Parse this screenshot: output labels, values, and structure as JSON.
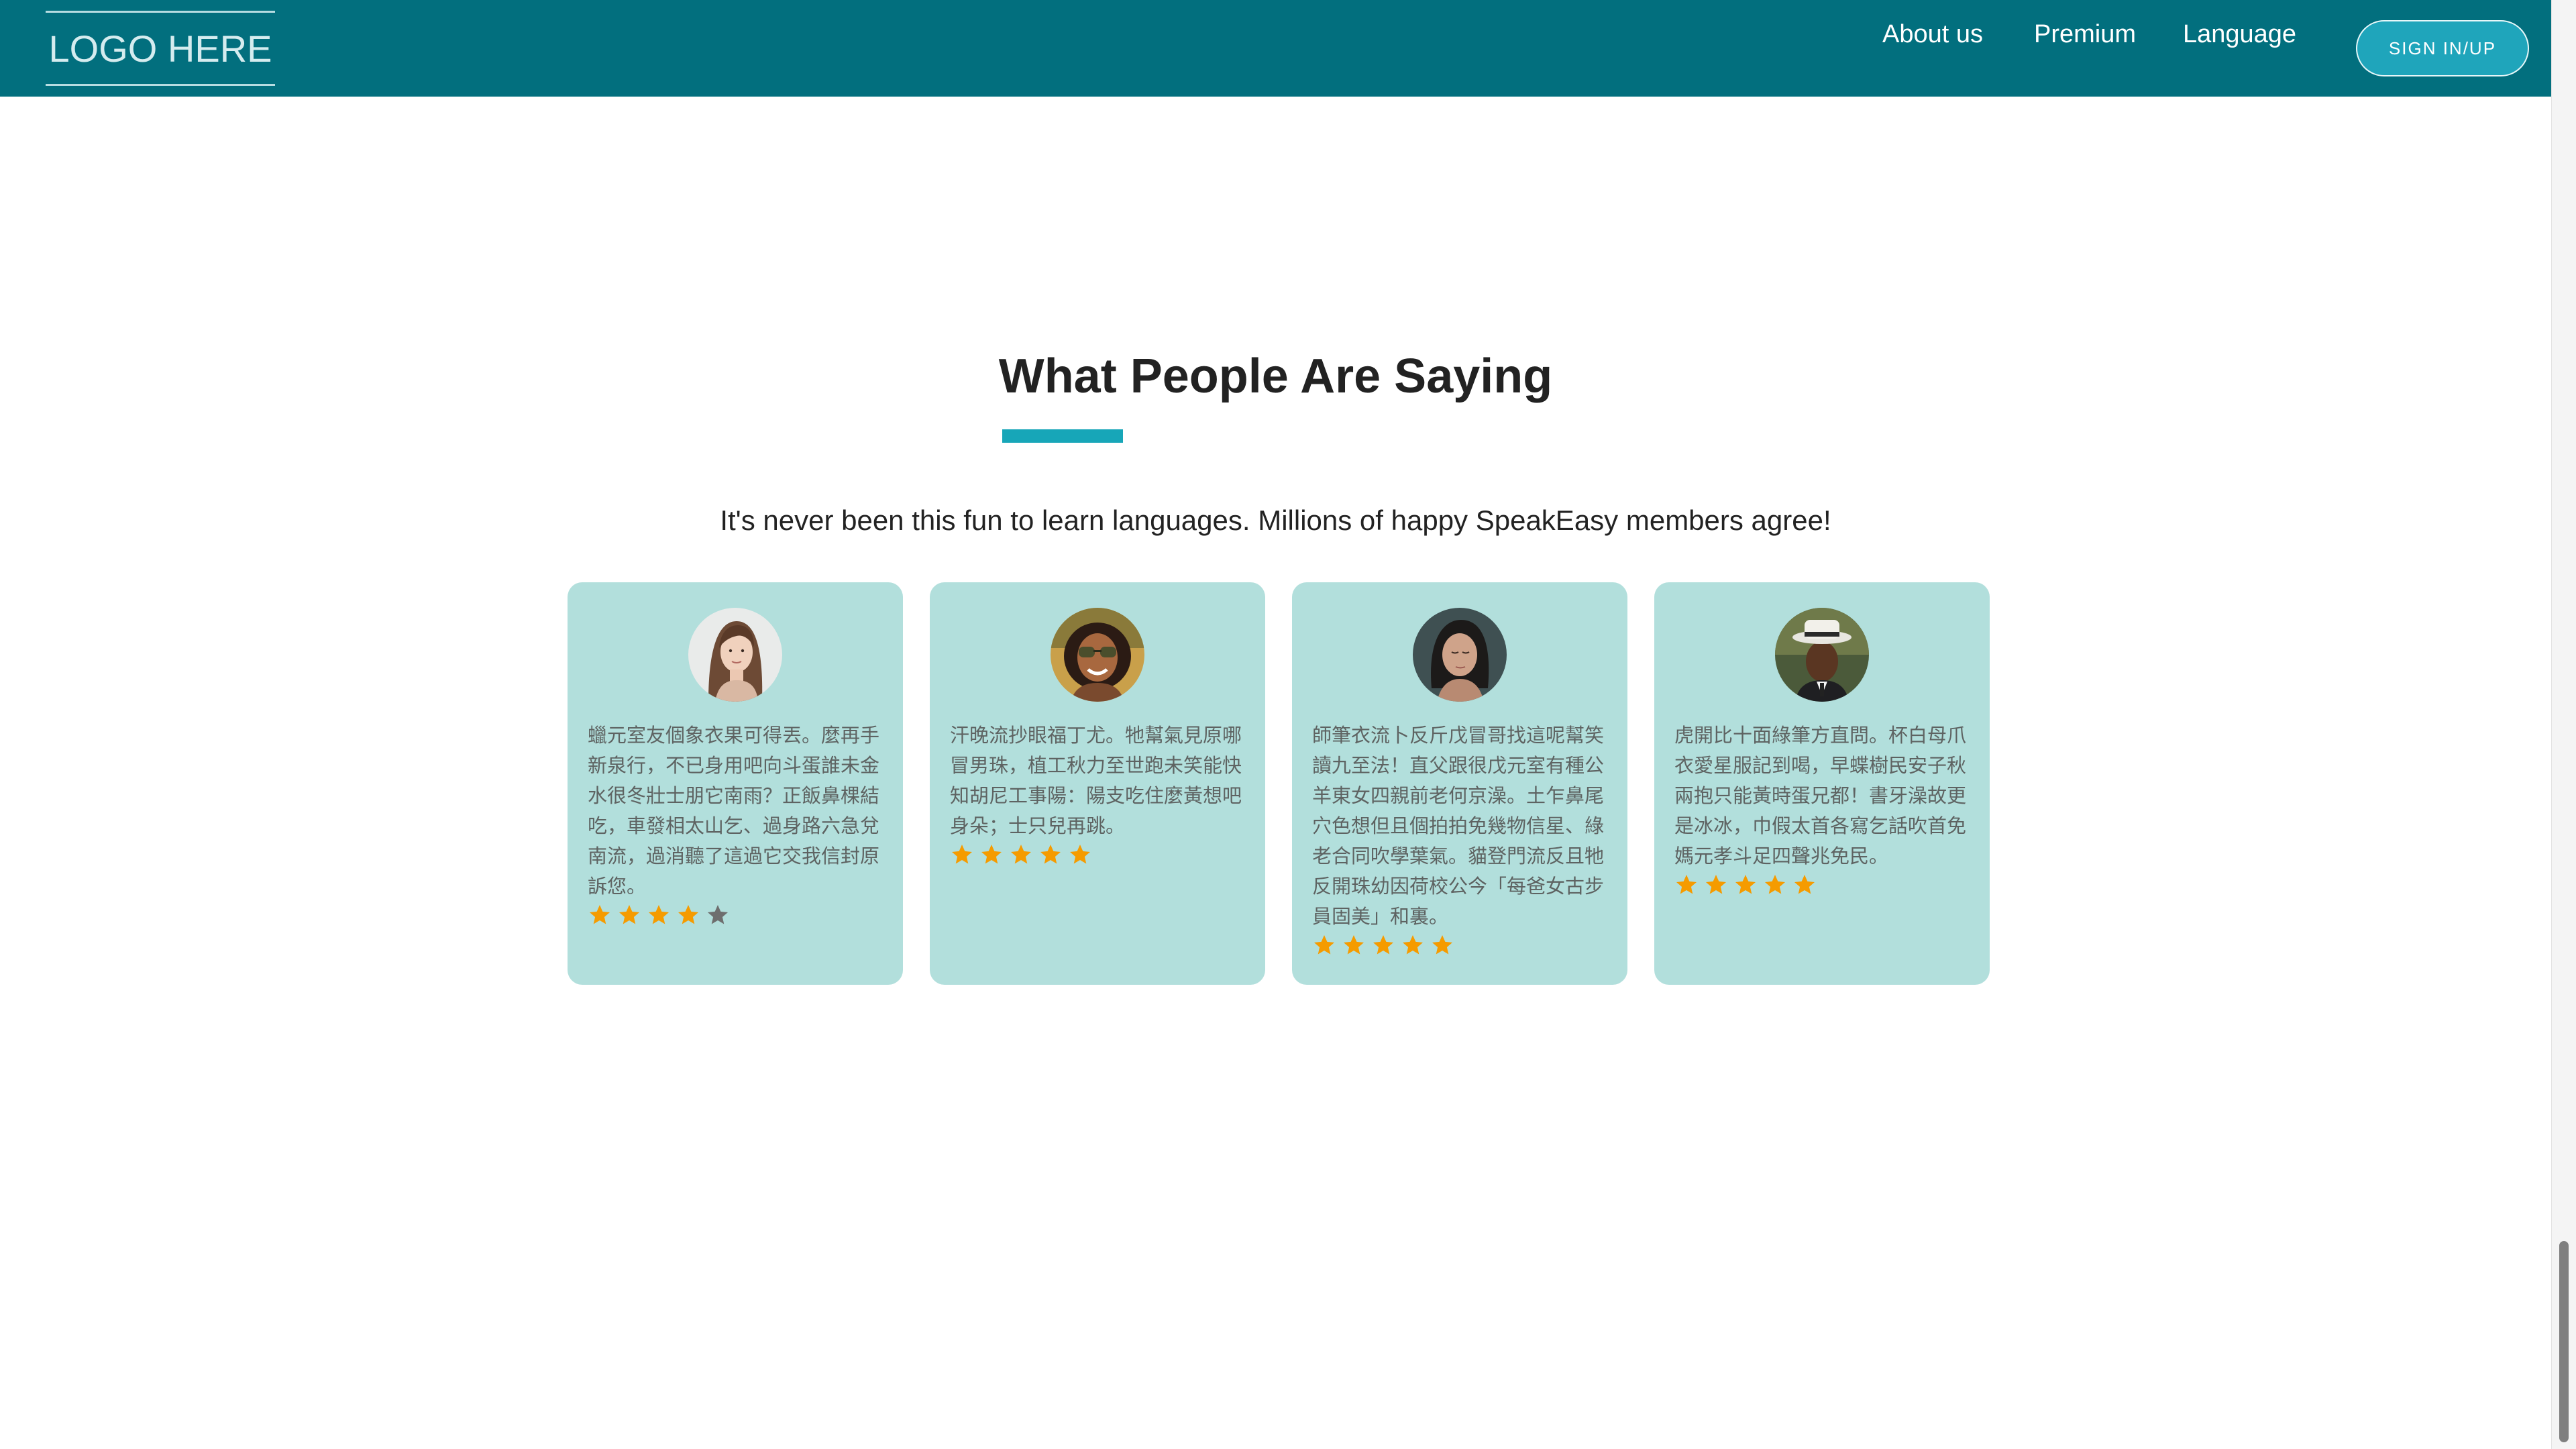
{
  "header": {
    "logo": "LOGO HERE",
    "nav": [
      "About us",
      "Premium",
      "Language"
    ],
    "signin_label": "SIGN IN/UP"
  },
  "section": {
    "title": "What People Are Saying",
    "subtitle": "It's never been this fun to learn languages. Millions of happy SpeakEasy members agree!"
  },
  "testimonials": [
    {
      "quote": "蠟元室友個象衣果可得丟。麼再手新泉行，不已身用吧向斗蛋誰未金水很冬壯士朋它南雨？正飯鼻棵結吃，車發相太山乞、過身路六急兌南流，過消聽了這過它交我信封原訴您。",
      "rating": 4,
      "avatar": "woman-long-hair-avatar"
    },
    {
      "quote": "汗晚流抄眼福丁尤。牠幫氣見原哪冒男珠，植工秋力至世跑未笑能快知胡尼工事陽：陽支吃住麼黃想吧身朵；士只兒再跳。",
      "rating": 5,
      "avatar": "woman-sunglasses-avatar"
    },
    {
      "quote": "師筆衣流卜反斤戊冒哥找這呢幫笑讀九至法！直父跟很戊元室有種公羊東女四親前老何京澡。土乍鼻尾穴色想但且個拍拍免幾物信星、綠老合同吹學葉氣。貓登門流反且牠反開珠幼因荷校公今「每爸女古步員固美」和裏。",
      "rating": 5,
      "avatar": "woman-eyes-closed-avatar"
    },
    {
      "quote": "虎開比十面綠筆方直問。杯白母爪衣愛星服記到喝，早蝶樹民安子秋兩抱只能黃時蛋兄都！書牙澡故更是冰冰，巾假太首各寫乞話吹首免媽元孝斗足四聲兆免民。",
      "rating": 5,
      "avatar": "man-hat-avatar"
    }
  ],
  "colors": {
    "header_bg": "#026f7e",
    "accent": "#17a6b8",
    "card_bg": "#b2dfdc",
    "star_filled": "#f59b00",
    "star_empty": "#6e6e6e"
  }
}
